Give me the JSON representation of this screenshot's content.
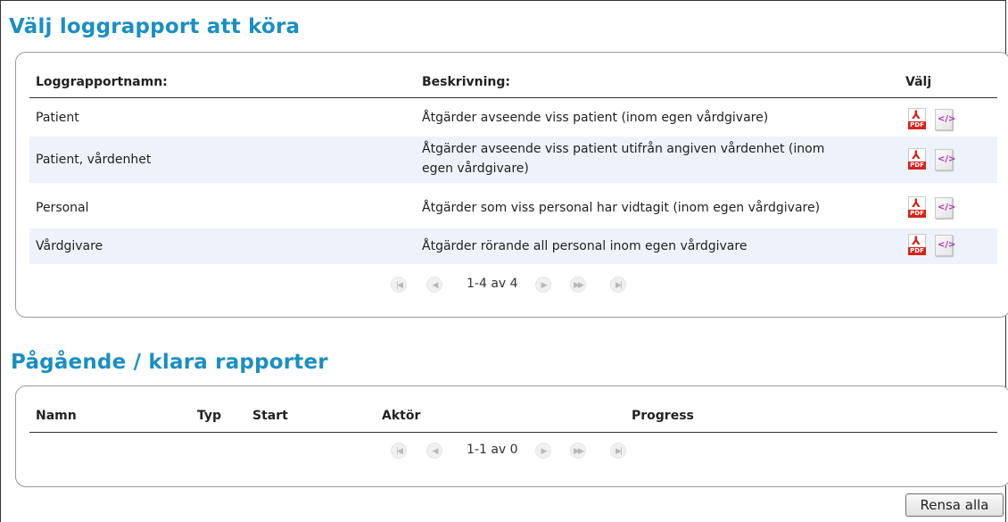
{
  "section1": {
    "title": "Välj loggrapport att köra",
    "columns": {
      "name": "Loggrapportnamn:",
      "description": "Beskrivning:",
      "select": "Välj"
    },
    "rows": [
      {
        "name": "Patient",
        "description": "Åtgärder avseende viss patient (inom egen vårdgivare)"
      },
      {
        "name": "Patient, vårdenhet",
        "description": "Åtgärder avseende viss patient utifrån angiven vårdenhet (inom",
        "description2": "egen vårdgivare)"
      },
      {
        "name": "Personal",
        "description": "Åtgärder som viss personal har vidtagit (inom egen vårdgivare)"
      },
      {
        "name": "Vårdgivare",
        "description": "Åtgärder rörande all personal inom egen vårdgivare"
      }
    ],
    "pager": {
      "info": "1-4 av 4"
    },
    "icons": {
      "pdf": "pdf-file-icon",
      "xml": "xml-file-icon",
      "pdf_text": "PDF",
      "xml_text": "</>"
    }
  },
  "section2": {
    "title": "Pågående / klara rapporter",
    "columns": {
      "name": "Namn",
      "type": "Typ",
      "start": "Start",
      "actor": "Aktör",
      "progress": "Progress"
    },
    "pager": {
      "info": "1-1 av 0"
    }
  },
  "buttons": {
    "clear_all": "Rensa alla"
  },
  "pager_icons": {
    "first": "first-page-icon",
    "prev": "previous-page-icon",
    "next": "next-page-icon",
    "fast_forward": "fast-forward-icon",
    "last": "last-page-icon"
  }
}
